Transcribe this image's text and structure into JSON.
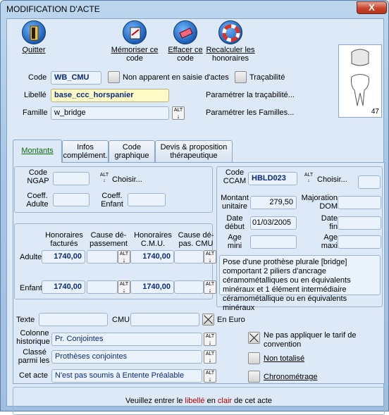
{
  "window": {
    "title": "MODIFICATION D'ACTE",
    "close_label": "X"
  },
  "toolbar": {
    "quit": "Quitter",
    "memorize": [
      "Mémoriser ce",
      "code"
    ],
    "erase": [
      "Effacer ce",
      "code"
    ],
    "recalc": [
      "Recalculer les",
      "honoraires"
    ]
  },
  "header": {
    "code_label": "Code",
    "code_value": "WB_CMU",
    "non_apparent": "Non apparent en saisie d'actes",
    "tracabilite": "Traçabilité",
    "libelle_label": "Libellé",
    "libelle_value": "base_ccc_horspanier",
    "param_trac": "Paramétrer la traçabilité...",
    "famille_label": "Famille",
    "famille_value": "w_bridge",
    "param_fam": "Paramétrer les Familles...",
    "tooth_number": "47"
  },
  "tabs": [
    "Montants",
    "Infos",
    "complément.",
    "Code",
    "graphique",
    "Devis & proposition",
    "thérapeutique"
  ],
  "ngap": {
    "code_l1": "Code",
    "code_l2": "NGAP",
    "choisir": "Choisir...",
    "coeff_adulte_l1": "Coeff.",
    "coeff_adulte_l2": "Adulte",
    "coeff_enfant_l1": "Coeff.",
    "coeff_enfant_l2": "Enfant"
  },
  "honoraires": {
    "h1": [
      "Honoraires",
      "facturés"
    ],
    "h2": [
      "Cause dé-",
      "passement"
    ],
    "h3": [
      "Honoraires",
      "C.M.U."
    ],
    "h4": [
      "Cause dé-",
      "pas. CMU"
    ],
    "adulte_label": "Adulte",
    "adulte_fact": "1740,00",
    "adulte_cmu": "1740,00",
    "enfant_label": "Enfant",
    "enfant_fact": "1740,00",
    "enfant_cmu": "1740,00"
  },
  "ccam": {
    "code_l1": "Code",
    "code_l2": "CCAM",
    "code_value": "HBLD023",
    "choisir": "Choisir...",
    "montant_l1": "Montant",
    "montant_l2": "unitaire",
    "montant_value": "279,50",
    "majoration_l1": "Majoration",
    "majoration_l2": "DOM",
    "date_debut_l1": "Date",
    "date_debut_l2": "début",
    "date_debut_value": "01/03/2005",
    "date_fin_l1": "Date",
    "date_fin_l2": "fin",
    "age_mini_l1": "Age",
    "age_mini_l2": "mini",
    "age_maxi_l1": "Age",
    "age_maxi_l2": "maxi",
    "description": "Pose d'une prothèse plurale [bridge] comportant 2 piliers d'ancrage céramométalliques ou en équivalents minéraux et 1 élément intermédiaire céramométallique ou en équivalents minéraux"
  },
  "bottom": {
    "texte": "Texte",
    "cmu": "CMU",
    "en_euro": "En Euro",
    "colonne_l1": "Colonne",
    "colonne_l2": "historique",
    "colonne_value": "Pr. Conjointes",
    "classe_l1": "Classé",
    "classe_l2": "parmi les",
    "classe_value": "Prothèses conjointes",
    "cet_acte": "Cet acte",
    "cet_acte_value": "N'est pas soumis à Entente Préalable",
    "ne_pas_appliquer_l1": "Ne pas appliquer le tarif de",
    "ne_pas_appliquer_l2": "convention",
    "non_totalise": "Non totalisé",
    "chronometrage": "Chronométrage"
  },
  "status": {
    "p1": "Veuillez entrer le ",
    "p2": "libellé",
    "p3": " en ",
    "p4": "clair",
    "p5": " de cet acte"
  }
}
